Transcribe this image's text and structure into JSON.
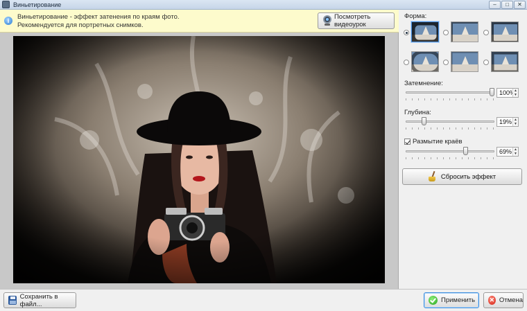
{
  "window": {
    "title": "Виньетирование",
    "controls": [
      "–",
      "□",
      "✕"
    ]
  },
  "info": {
    "text_line1": "Виньетирование - эффект затенения по краям фото.",
    "text_line2": "Рекомендуется для портретных снимков.",
    "video_button": "Посмотреть видеоурок"
  },
  "panel": {
    "shape_label": "Форма:",
    "shapes": [
      {
        "checked": true
      },
      {
        "checked": false
      },
      {
        "checked": false
      },
      {
        "checked": false
      },
      {
        "checked": false
      },
      {
        "checked": false
      }
    ],
    "darkening": {
      "label": "Затемнение:",
      "value": "100%",
      "fraction": 1.0
    },
    "depth": {
      "label": "Глубина:",
      "value": "19%",
      "fraction": 0.19
    },
    "blur": {
      "label": "Размытие краёв",
      "checked": true,
      "value": "69%",
      "fraction": 0.69
    },
    "reset_button": "Сбросить эффект"
  },
  "footer": {
    "save_button": "Сохранить в файл...",
    "apply_button": "Применить",
    "cancel_button": "Отмена"
  },
  "colors": {
    "info_bg": "#fdfbcc",
    "accent": "#3d8ede"
  }
}
